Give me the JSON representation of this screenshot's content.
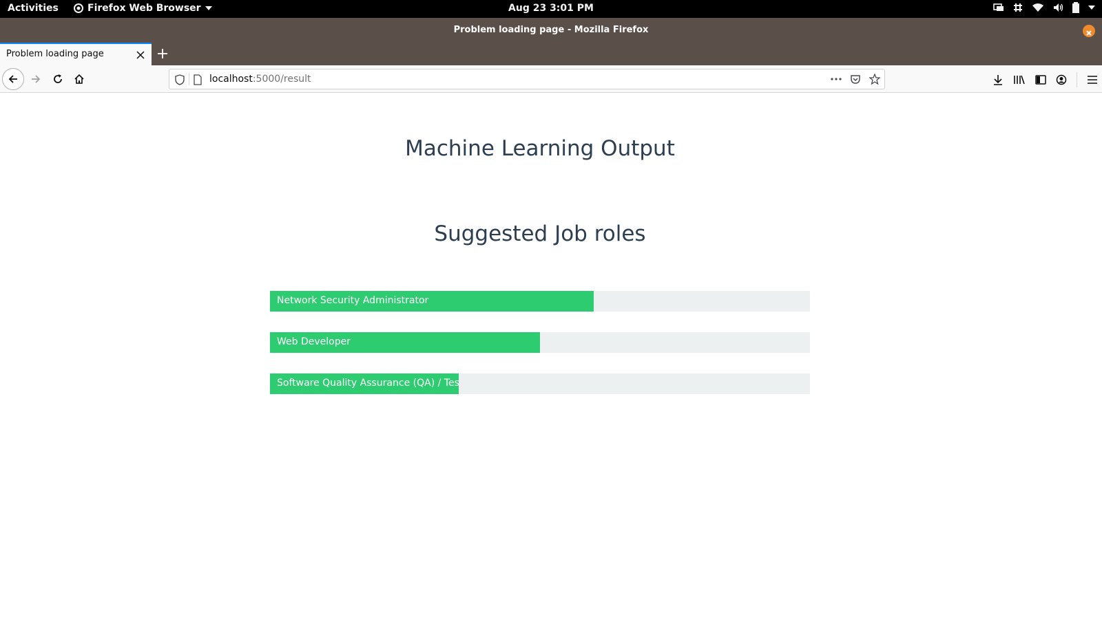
{
  "system": {
    "activities": "Activities",
    "app_menu": "Firefox Web Browser",
    "clock": "Aug 23  3:01 PM"
  },
  "window": {
    "title": "Problem loading page - Mozilla Firefox"
  },
  "tabs": [
    {
      "label": "Problem loading page",
      "active": true
    }
  ],
  "urlbar": {
    "host": "localhost",
    "rest": ":5000/result"
  },
  "page": {
    "title": "Machine Learning Output",
    "section_title": "Suggested Job roles",
    "roles": [
      {
        "label": "Network Security Administrator",
        "fraction": 0.6
      },
      {
        "label": "Web Developer",
        "fraction": 0.5
      },
      {
        "label": "Software Quality Assurance (QA) / Testing",
        "fraction": 0.35
      }
    ]
  },
  "colors": {
    "bar_fill": "#2ecc71",
    "bar_track": "#ecf0f1",
    "heading": "#2c3e50"
  }
}
